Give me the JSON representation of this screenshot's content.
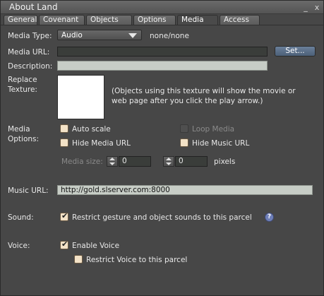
{
  "window": {
    "title": "About Land",
    "minimize_symbol": "_",
    "close_symbol": "x"
  },
  "tabs": [
    {
      "label": "General"
    },
    {
      "label": "Covenant"
    },
    {
      "label": "Objects"
    },
    {
      "label": "Options"
    },
    {
      "label": "Media"
    },
    {
      "label": "Access"
    }
  ],
  "active_tab": "Media",
  "media_type": {
    "label": "Media Type:",
    "value": "Audio",
    "status": "none/none"
  },
  "media_url": {
    "label": "Media URL:",
    "value": "",
    "set_button": "Set..."
  },
  "description": {
    "label": "Description:",
    "value": ""
  },
  "replace_texture": {
    "label_line1": "Replace",
    "label_line2": "Texture:",
    "note_line1": "(Objects using this texture will show the movie or",
    "note_line2": "web page after you click the play arrow.)"
  },
  "media_options": {
    "label_line1": "Media",
    "label_line2": "Options:",
    "auto_scale": {
      "label": "Auto scale",
      "checked": false
    },
    "loop_media": {
      "label": "Loop Media",
      "checked": false,
      "enabled": false
    },
    "hide_media_url": {
      "label": "Hide Media URL",
      "checked": false
    },
    "hide_music_url": {
      "label": "Hide Music URL",
      "checked": false
    },
    "media_size": {
      "label": "Media size:",
      "width": "0",
      "height": "0",
      "units": "pixels"
    }
  },
  "music_url": {
    "label": "Music URL:",
    "value": "http://gold.slserver.com:8000"
  },
  "sound": {
    "label": "Sound:",
    "restrict_label": "Restrict gesture and object sounds to this parcel",
    "checked": true,
    "help_symbol": "?"
  },
  "voice": {
    "label": "Voice:",
    "enable_label": "Enable Voice",
    "enable_checked": true,
    "restrict_label": "Restrict Voice to this parcel",
    "restrict_checked": false
  },
  "checkmark": "✔"
}
